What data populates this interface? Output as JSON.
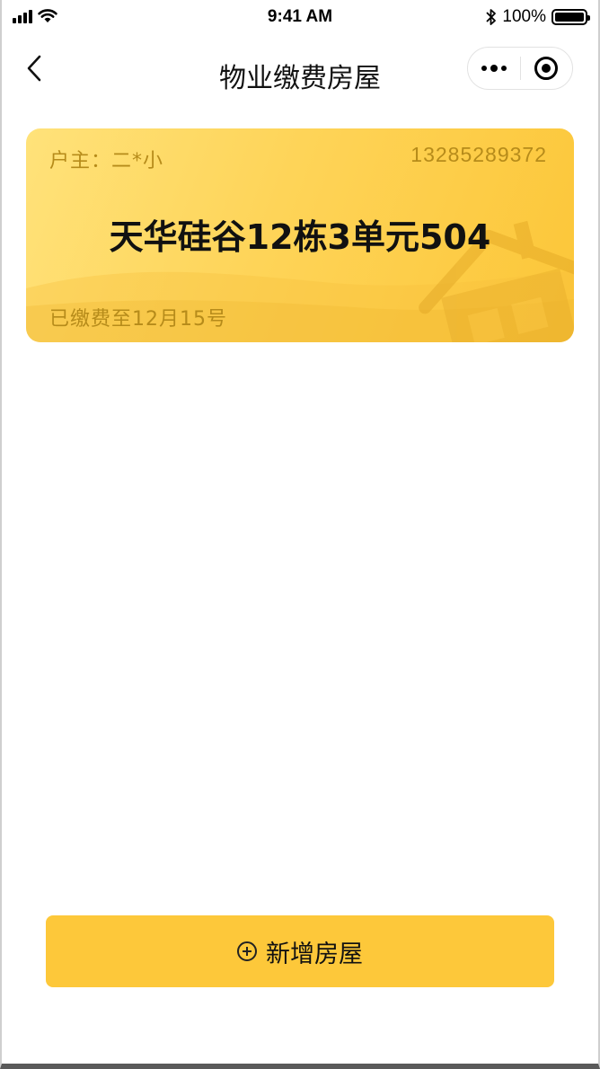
{
  "status_bar": {
    "time": "9:41 AM",
    "battery_text": "100%",
    "icons": [
      "signal-icon",
      "wifi-icon",
      "bluetooth-icon",
      "battery-icon"
    ]
  },
  "nav": {
    "title": "物业缴费房屋",
    "back_icon": "chevron-left-icon",
    "more_icon": "more-dots-icon",
    "close_icon": "target-circle-icon"
  },
  "house_card": {
    "owner_label": "户主：二*小",
    "phone": "13285289372",
    "address": "天华硅谷12栋3单元504",
    "paid_until": "已缴费至12月15号",
    "decoration_icon": "house-icon",
    "colors": {
      "gradient_start": "#ffe27a",
      "gradient_end": "#fcc638",
      "meta_text": "#b68b1a"
    }
  },
  "actions": {
    "add_house_label": "新增房屋",
    "add_house_icon": "plus-circle-icon",
    "button_color": "#fdc83a"
  }
}
